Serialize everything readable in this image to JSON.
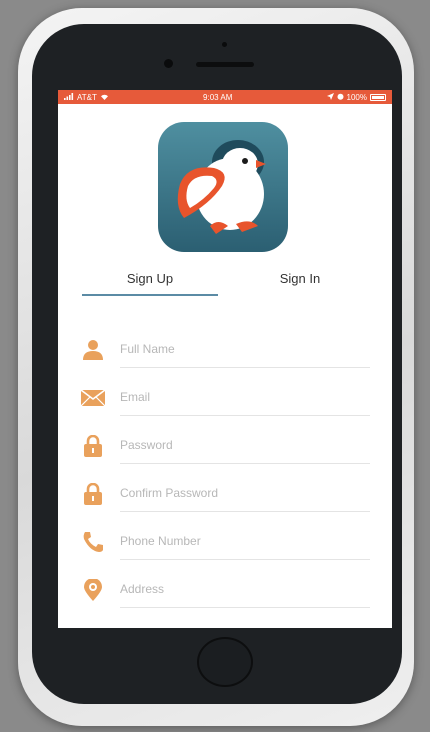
{
  "status_bar": {
    "carrier": "AT&T",
    "time": "9:03 AM",
    "battery": "100%"
  },
  "tabs": {
    "sign_up": "Sign Up",
    "sign_in": "Sign In",
    "active": "sign_up"
  },
  "form": {
    "fields": [
      {
        "icon": "person-icon",
        "placeholder": "Full Name",
        "value": ""
      },
      {
        "icon": "envelope-icon",
        "placeholder": "Email",
        "value": ""
      },
      {
        "icon": "lock-icon",
        "placeholder": "Password",
        "value": ""
      },
      {
        "icon": "lock-icon",
        "placeholder": "Confirm Password",
        "value": ""
      },
      {
        "icon": "phone-icon",
        "placeholder": "Phone Number",
        "value": ""
      },
      {
        "icon": "location-pin-icon",
        "placeholder": "Address",
        "value": ""
      }
    ]
  },
  "colors": {
    "status_bar": "#e65a3a",
    "accent_icon": "#e9a15c",
    "tab_underline": "#5b8ba5",
    "app_icon_bg": "#3c7384",
    "penguin_accent": "#e8542c"
  }
}
